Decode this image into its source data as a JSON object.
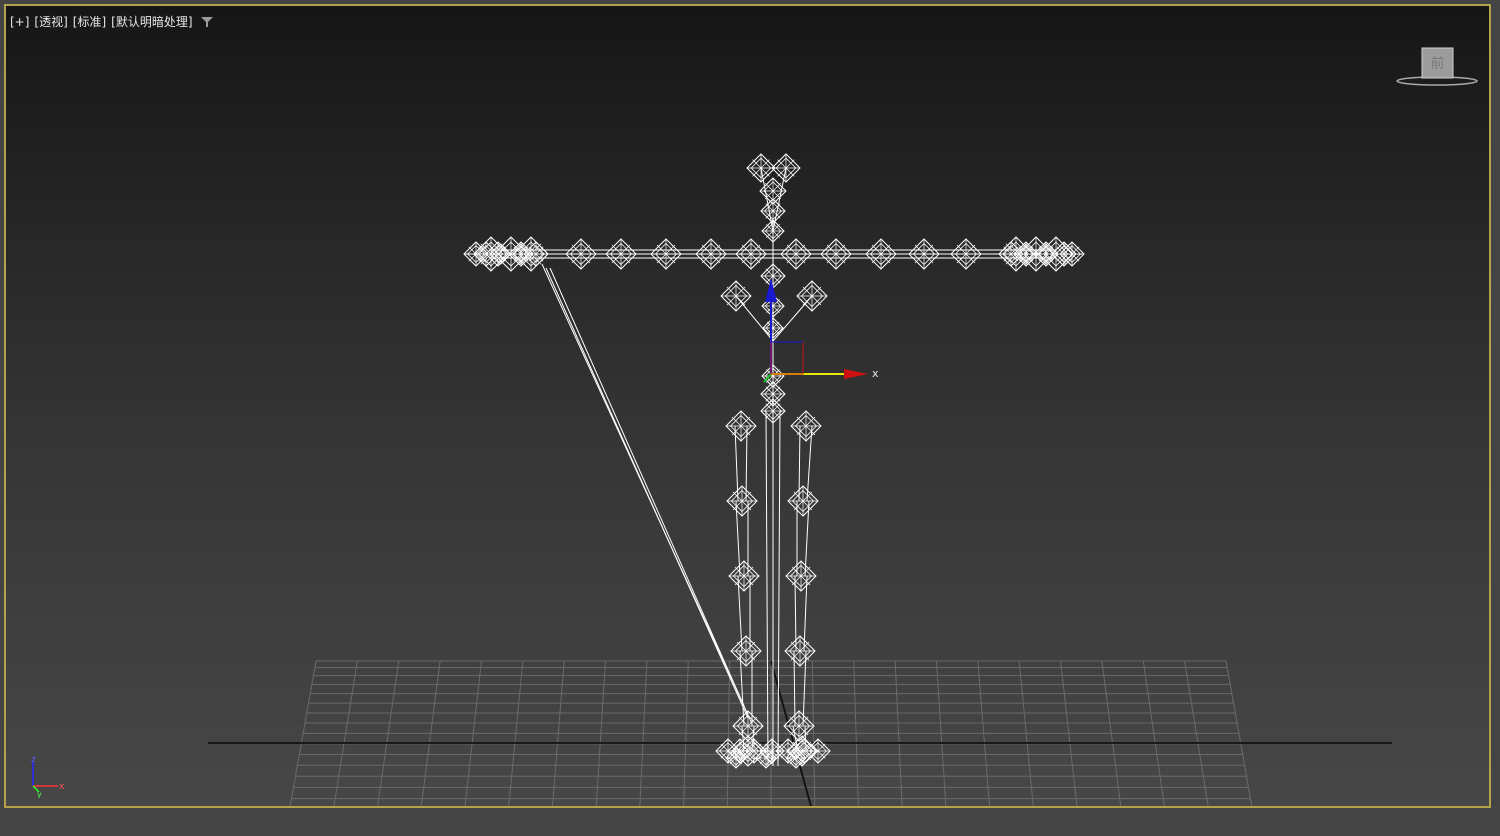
{
  "viewport": {
    "labels": {
      "plus": "[+]",
      "view": "[透视]",
      "shading": "[标准]",
      "lighting": "[默认明暗处理]"
    },
    "filter_icon": "filter-icon",
    "frame_color": "#b3a24a",
    "background_top": "#161616",
    "background_bottom": "#474747"
  },
  "gizmo": {
    "x_label": "x",
    "x_color": "#cc1111",
    "y_color": "#e8e800",
    "z_color": "#1a1ad0"
  },
  "viewcube": {
    "face_label": "前"
  },
  "axis_tripod": {
    "z_label": "z",
    "x_label": "x",
    "y_label": "y"
  },
  "wireframe_color": "#ffffff",
  "grid_color": "#6a6a6a",
  "grid_axis_color": "#111111"
}
